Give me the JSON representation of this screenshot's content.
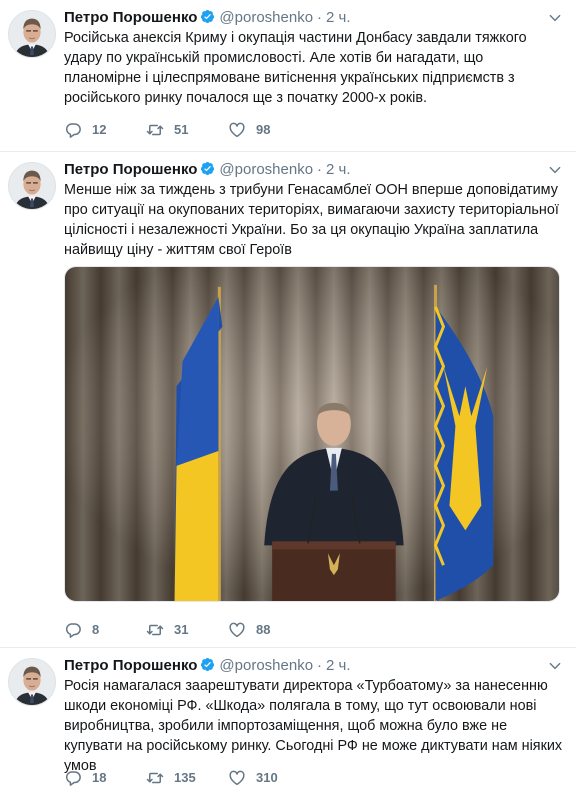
{
  "author": {
    "name": "Петро Порошенко",
    "handle": "@poroshenko",
    "separator": "·"
  },
  "tweets": [
    {
      "time": "2 ч.",
      "text": "Російська анексія Криму і окупація частини Донбасу завдали тяжкого удару по українській промисловості. Але хотів би нагадати, що планомірне і цілеспрямоване витіснення українських підприємств з російського ринку почалося ще з початку 2000-х років.",
      "replies": "12",
      "retweets": "51",
      "likes": "98"
    },
    {
      "time": "2 ч.",
      "text": "Менше ніж за тиждень з трибуни Генасамблеї ООН вперше доповідатиму про ситуації на окупованих територіях, вимагаючи захисту територіальної цілісності і незалежності України. Бо за ця окупацію Україна заплатила найвищу ціну - життям свої Героїв",
      "replies": "8",
      "retweets": "31",
      "likes": "88"
    },
    {
      "time": "2 ч.",
      "text": "Росія намагалася заарештувати директора «Турбоатому» за нанесенню шкоди економіці РФ. «Шкода» полягала в тому, що тут освоювали нові виробництва, зробили імпортозаміщення, щоб можна було вже не купувати на російському ринку. Сьогодні РФ не може диктувати нам ніяких умов",
      "replies": "18",
      "retweets": "135",
      "likes": "310"
    }
  ],
  "colors": {
    "verified": "#1da1f2",
    "muted": "#657786",
    "divider": "#e6ecf0",
    "flag_blue": "#1f4fa8",
    "flag_yellow": "#f3c623"
  },
  "icons": [
    "verified-badge-icon",
    "caret-down-icon",
    "reply-icon",
    "retweet-icon",
    "like-icon"
  ]
}
